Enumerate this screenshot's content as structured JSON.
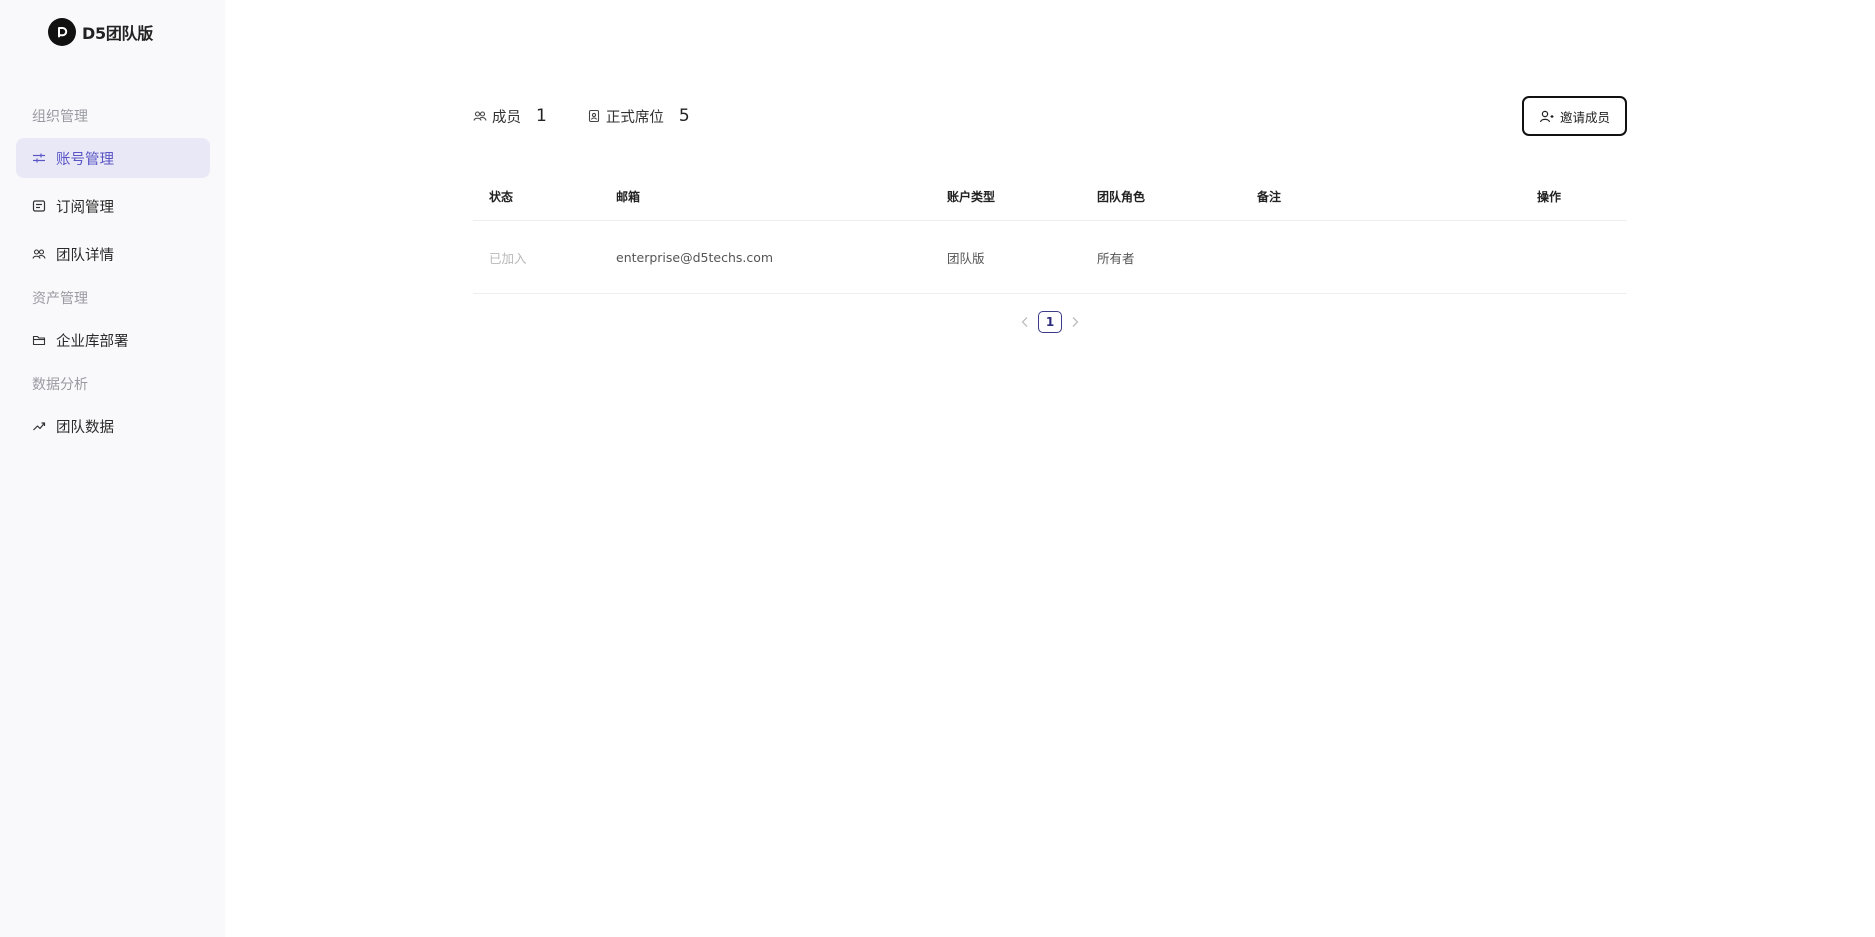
{
  "brand": {
    "name": "D5团队版"
  },
  "sidebar": {
    "sections": [
      {
        "label": "组织管理"
      },
      {
        "label": "资产管理"
      },
      {
        "label": "数据分析"
      }
    ],
    "items": [
      {
        "label": "账号管理",
        "icon": "sliders-icon",
        "active": true
      },
      {
        "label": "订阅管理",
        "icon": "receipt-icon"
      },
      {
        "label": "团队详情",
        "icon": "team-icon"
      },
      {
        "label": "企业库部署",
        "icon": "folder-icon"
      },
      {
        "label": "团队数据",
        "icon": "trend-icon"
      }
    ]
  },
  "stats": {
    "members_label": "成员",
    "members_value": "1",
    "seats_label": "正式席位",
    "seats_value": "5"
  },
  "actions": {
    "invite_label": "邀请成员"
  },
  "table": {
    "columns": [
      "状态",
      "邮箱",
      "账户类型",
      "团队角色",
      "备注",
      "操作"
    ],
    "rows": [
      {
        "status": "已加入",
        "email": "enterprise@d5techs.com",
        "account_type": "团队版",
        "role": "所有者",
        "note": "",
        "action": ""
      }
    ]
  },
  "pagination": {
    "current": "1"
  },
  "colors": {
    "accent": "#5a56c6",
    "active_bg": "#e9e8f7",
    "sidebar_bg": "#f9f9fb"
  }
}
